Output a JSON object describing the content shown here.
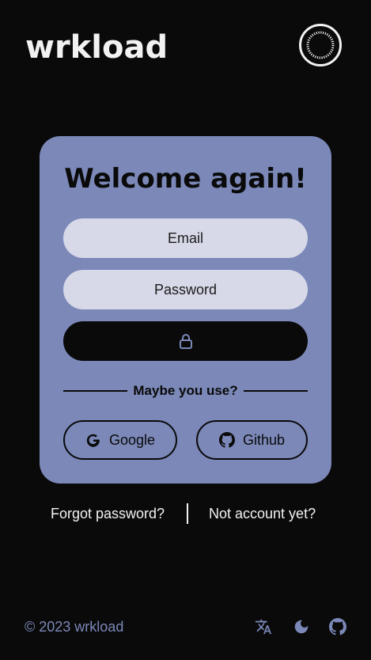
{
  "header": {
    "logo": "wrkload"
  },
  "login": {
    "title": "Welcome again!",
    "email_placeholder": "Email",
    "password_placeholder": "Password",
    "divider_text": "Maybe you use?",
    "google_label": "Google",
    "github_label": "Github"
  },
  "links": {
    "forgot": "Forgot password?",
    "signup": "Not account yet?"
  },
  "footer": {
    "copyright": "© 2023 wrkload"
  },
  "colors": {
    "background": "#0a0a0a",
    "card": "#7b88b8",
    "field": "#d7d9e8",
    "accent": "#7b88b8"
  }
}
